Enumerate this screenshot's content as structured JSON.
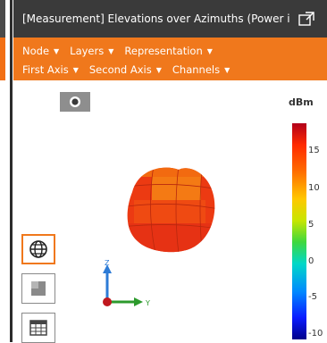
{
  "window": {
    "title": "[Measurement] Elevations over Azimuths (Power in dE"
  },
  "toolbar": {
    "row1": [
      "Node",
      "Layers",
      "Representation"
    ],
    "row2": [
      "First Axis",
      "Second Axis",
      "Channels"
    ]
  },
  "legend": {
    "unit": "dBm",
    "ticks": [
      "15",
      "10",
      "5",
      "0",
      "-5",
      "-10"
    ]
  },
  "axes": {
    "z_label": "Z",
    "y_label": "Y"
  },
  "icons": {
    "camera": "camera-icon",
    "popout": "popout-icon",
    "globe": "globe-icon",
    "cube": "cube-view-icon",
    "table": "table-view-icon"
  },
  "colors": {
    "accent": "#f0781c",
    "titlebar": "#3a3a3a"
  }
}
